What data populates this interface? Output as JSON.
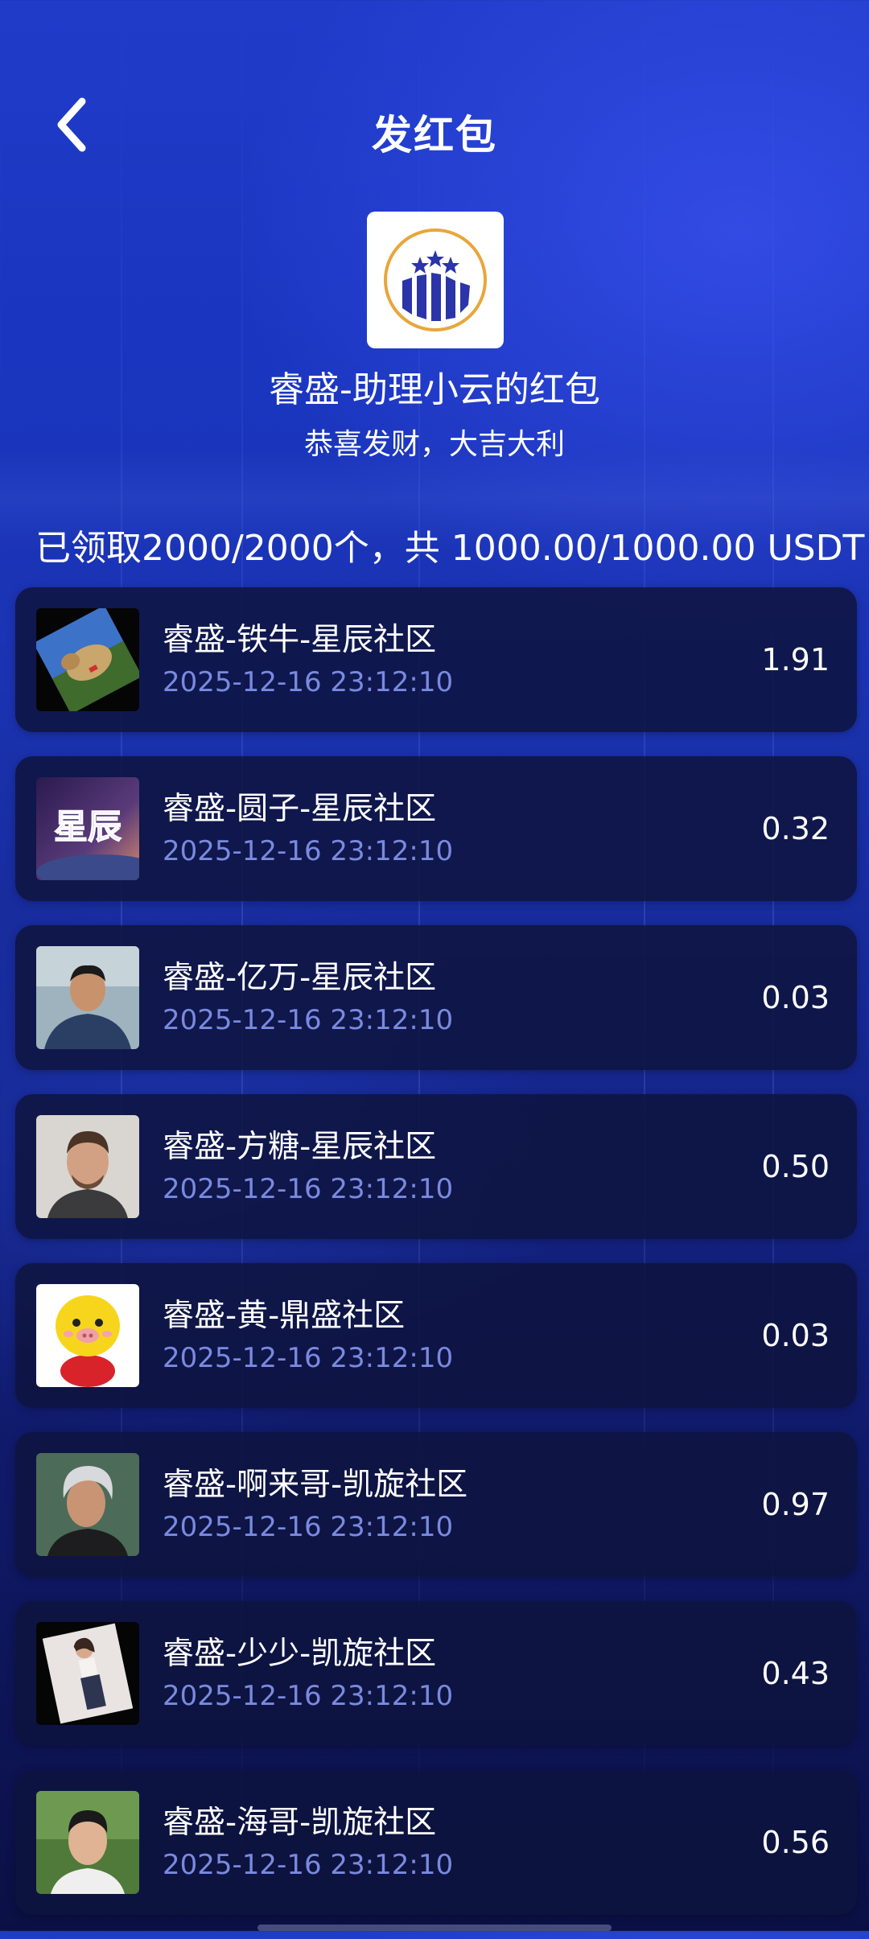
{
  "header": {
    "title": "发红包",
    "back_icon": "chevron-left-icon"
  },
  "sender": {
    "logo_icon": "rise-logo-icon",
    "name": "睿盛-助理小云的红包",
    "blessing": "恭喜发财，大吉大利"
  },
  "summary": "已领取2000/2000个，共 1000.00/1000.00 USDT",
  "records": [
    {
      "name": "睿盛-铁牛-星辰社区",
      "time": "2025-12-16 23:12:10",
      "amount": "1.91",
      "avatar": "dog-photo"
    },
    {
      "name": "睿盛-圆子-星辰社区",
      "time": "2025-12-16 23:12:10",
      "amount": "0.32",
      "avatar": "星辰"
    },
    {
      "name": "睿盛-亿万-星辰社区",
      "time": "2025-12-16 23:12:10",
      "amount": "0.03",
      "avatar": "man-outdoor-photo"
    },
    {
      "name": "睿盛-方糖-星辰社区",
      "time": "2025-12-16 23:12:10",
      "amount": "0.50",
      "avatar": "man-portrait-photo"
    },
    {
      "name": "睿盛-黄-鼎盛社区",
      "time": "2025-12-16 23:12:10",
      "amount": "0.03",
      "avatar": "yellow-pig-toy"
    },
    {
      "name": "睿盛-啊来哥-凯旋社区",
      "time": "2025-12-16 23:12:10",
      "amount": "0.97",
      "avatar": "silver-hair-man-photo"
    },
    {
      "name": "睿盛-少少-凯旋社区",
      "time": "2025-12-16 23:12:10",
      "amount": "0.43",
      "avatar": "woman-photo"
    },
    {
      "name": "睿盛-海哥-凯旋社区",
      "time": "2025-12-16 23:12:10",
      "amount": "0.56",
      "avatar": "young-man-photo"
    }
  ],
  "colors": {
    "background_top": "#1f3bc8",
    "background_bottom": "#0b1044",
    "card": "#0e143e",
    "time_text": "#7a8ae0",
    "logo_blue": "#2b34a8",
    "logo_gold": "#e8a63a"
  }
}
